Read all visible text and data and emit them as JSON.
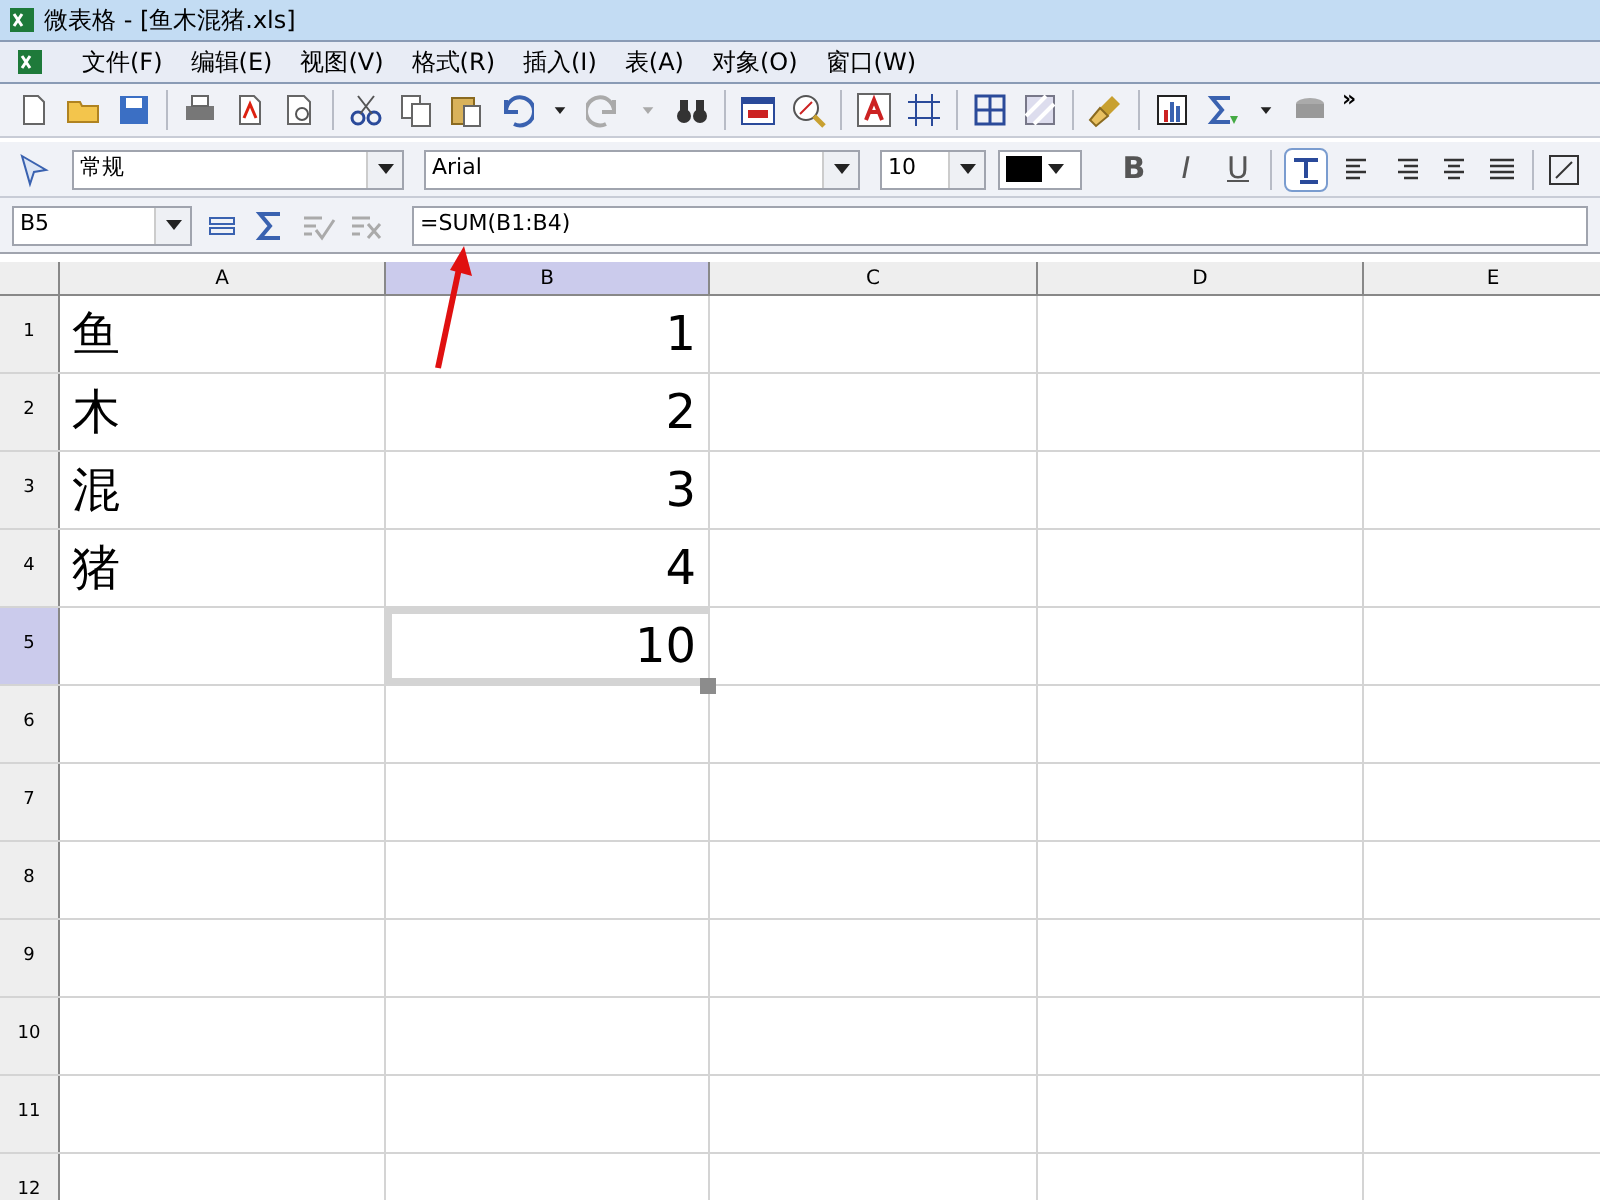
{
  "window": {
    "title": "微表格 - [鱼木混猪.xls]"
  },
  "menu": [
    "文件(F)",
    "编辑(E)",
    "视图(V)",
    "格式(R)",
    "插入(I)",
    "表(A)",
    "对象(O)",
    "窗口(W)"
  ],
  "toolbar": {
    "more": "»"
  },
  "format_bar": {
    "style": "常规",
    "font": "Arial",
    "size": "10",
    "buttons": [
      {
        "label": "B",
        "kind": "bold"
      },
      {
        "label": "I",
        "kind": "italic"
      },
      {
        "label": "U",
        "kind": "underline"
      }
    ],
    "wrap_pressed": true
  },
  "formula_bar": {
    "cell": "B5",
    "formula": "=SUM(B1:B4)"
  },
  "columns": [
    {
      "label": "A",
      "selected": false
    },
    {
      "label": "B",
      "selected": true
    },
    {
      "label": "C",
      "selected": false
    },
    {
      "label": "D",
      "selected": false
    },
    {
      "label": "E",
      "selected": false
    }
  ],
  "rows": [
    {
      "label": "1",
      "selected": false,
      "cells": [
        "鱼",
        "1",
        "",
        "",
        ""
      ]
    },
    {
      "label": "2",
      "selected": false,
      "cells": [
        "木",
        "2",
        "",
        "",
        ""
      ]
    },
    {
      "label": "3",
      "selected": false,
      "cells": [
        "混",
        "3",
        "",
        "",
        ""
      ]
    },
    {
      "label": "4",
      "selected": false,
      "cells": [
        "猪",
        "4",
        "",
        "",
        ""
      ]
    },
    {
      "label": "5",
      "selected": true,
      "cells": [
        "",
        "10",
        "",
        "",
        ""
      ]
    },
    {
      "label": "6",
      "selected": false,
      "cells": [
        "",
        "",
        "",
        "",
        ""
      ]
    },
    {
      "label": "7",
      "selected": false,
      "cells": [
        "",
        "",
        "",
        "",
        ""
      ]
    },
    {
      "label": "8",
      "selected": false,
      "cells": [
        "",
        "",
        "",
        "",
        ""
      ]
    },
    {
      "label": "9",
      "selected": false,
      "cells": [
        "",
        "",
        "",
        "",
        ""
      ]
    },
    {
      "label": "10",
      "selected": false,
      "cells": [
        "",
        "",
        "",
        "",
        ""
      ]
    },
    {
      "label": "11",
      "selected": false,
      "cells": [
        "",
        "",
        "",
        "",
        ""
      ]
    },
    {
      "label": "12",
      "selected": false,
      "cells": [
        "",
        "",
        "",
        "",
        ""
      ]
    }
  ],
  "selection_handle": true
}
